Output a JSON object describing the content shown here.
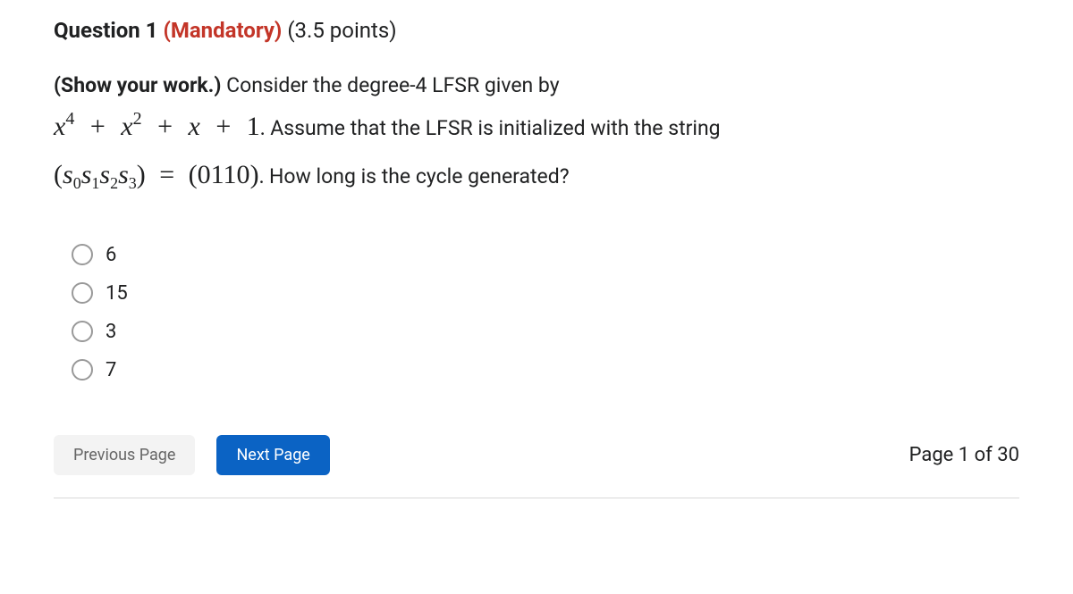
{
  "header": {
    "question_label": "Question 1",
    "mandatory_label": "(Mandatory)",
    "points_label": "(3.5 points)"
  },
  "body": {
    "show_work": "(Show your work.)",
    "intro_text": " Consider the degree-4 LFSR given by",
    "poly_x": "x",
    "poly_exp4": "4",
    "poly_exp2": "2",
    "poly_plus": "+",
    "poly_one": "1",
    "poly_dot": ".",
    "assume_text": " Assume that the LFSR is initialized with the string ",
    "state_open": "(",
    "state_s": "s",
    "state_sub0": "0",
    "state_sub1": "1",
    "state_sub2": "2",
    "state_sub3": "3",
    "state_close": ")",
    "state_eq": "=",
    "state_val_open": "(",
    "state_val": "0110",
    "state_val_close": ")",
    "state_dot": ".",
    "how_long": " How long is the cycle generated?"
  },
  "options": [
    {
      "label": "6"
    },
    {
      "label": "15"
    },
    {
      "label": "3"
    },
    {
      "label": "7"
    }
  ],
  "nav": {
    "prev": "Previous Page",
    "next": "Next Page",
    "page_indicator": "Page 1 of 30"
  }
}
